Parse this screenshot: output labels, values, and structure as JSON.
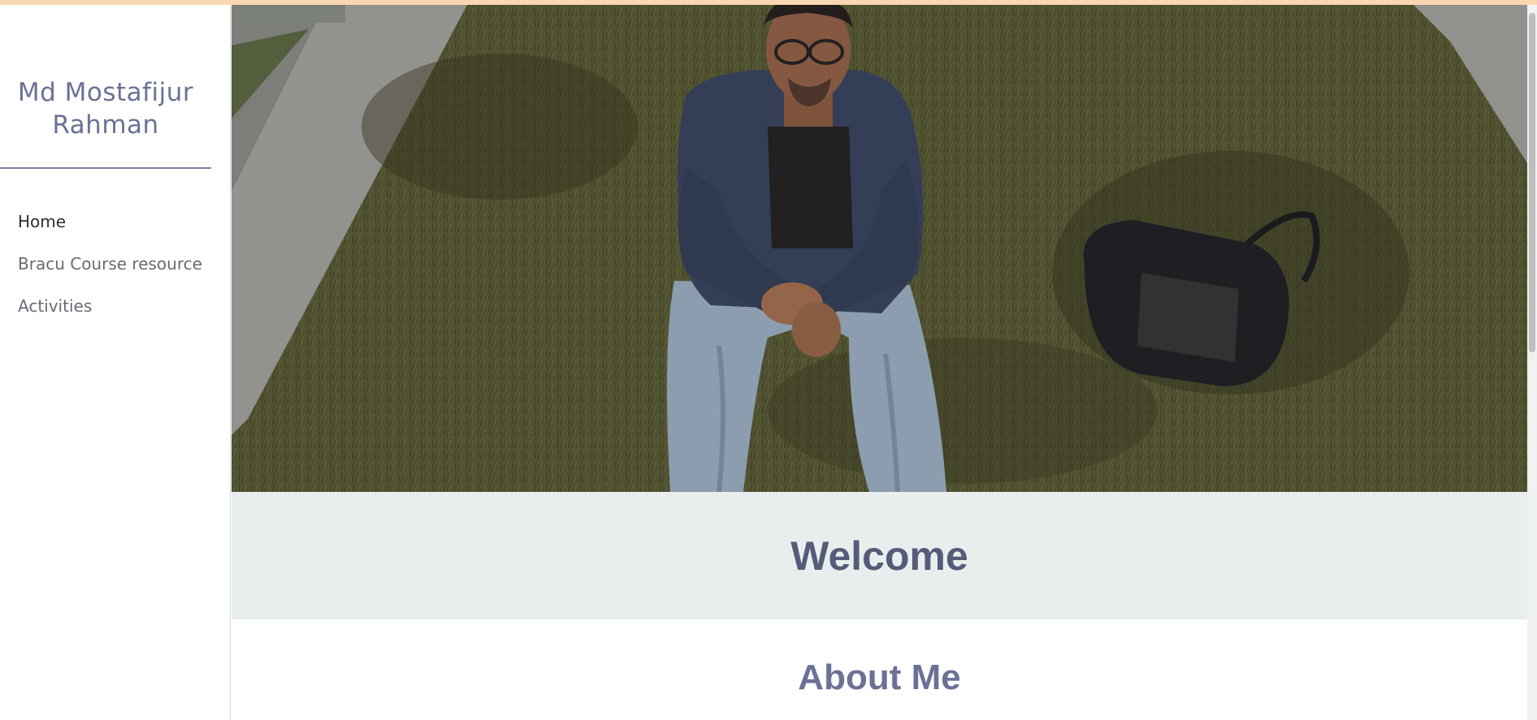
{
  "sidebar": {
    "title": "Md Mostafijur Rahman",
    "nav": [
      {
        "label": "Home",
        "active": true
      },
      {
        "label": "Bracu Course resource",
        "active": false
      },
      {
        "label": "Activities",
        "active": false
      }
    ]
  },
  "main": {
    "hero_image": "photo of a person sitting on grass with a backpack",
    "welcome_heading": "Welcome",
    "about_heading": "About Me"
  },
  "colors": {
    "accent": "#6b7196",
    "heading_dark": "#575b79",
    "band_background": "#e7eeed",
    "top_strip": "#f8d7b2"
  }
}
